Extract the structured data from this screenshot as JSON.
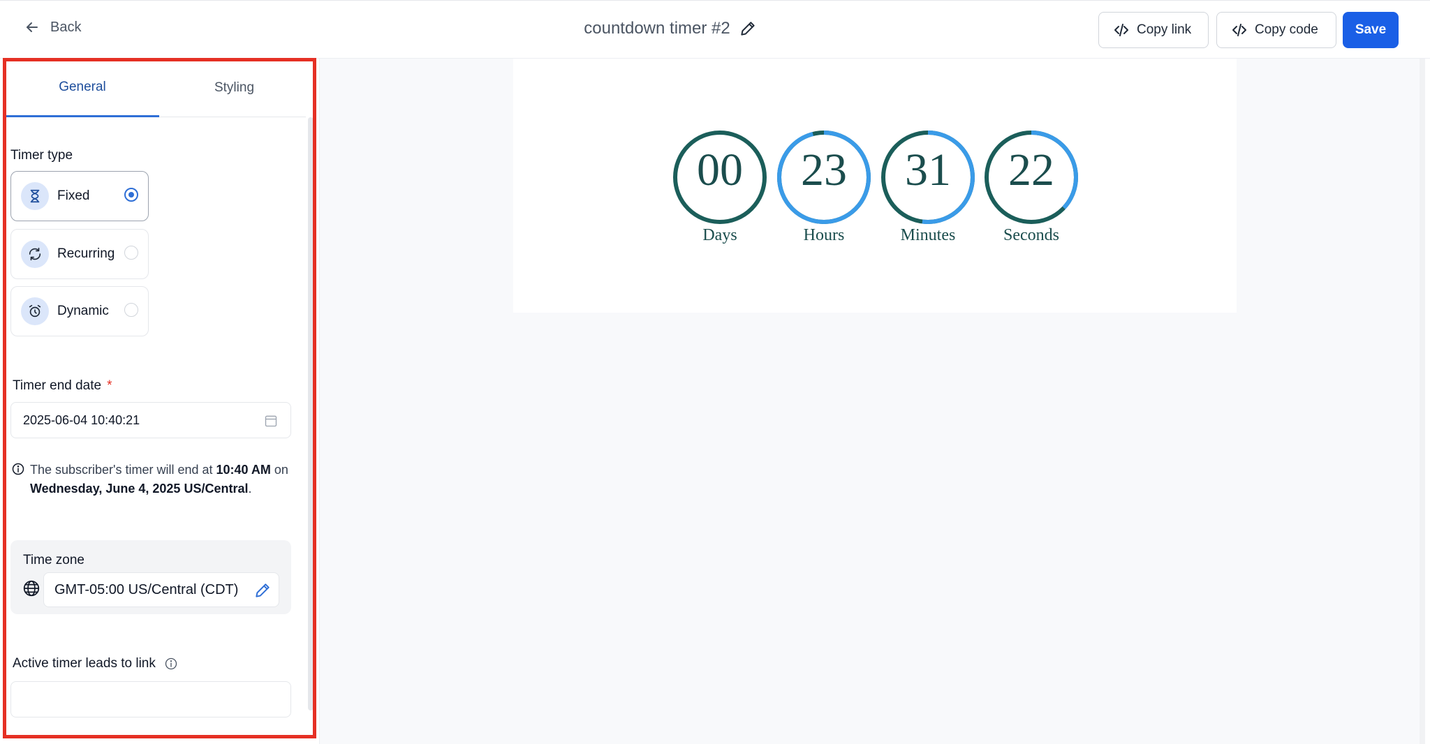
{
  "header": {
    "back_label": "Back",
    "title": "countdown timer #2",
    "copy_link_label": "Copy link",
    "copy_code_label": "Copy code",
    "save_label": "Save",
    "accent": "#1a5fe6"
  },
  "sidebar": {
    "tabs": [
      {
        "label": "General",
        "active": true
      },
      {
        "label": "Styling",
        "active": false
      }
    ],
    "timer_type_label": "Timer type",
    "timer_types": [
      {
        "label": "Fixed",
        "icon": "hourglass-icon",
        "selected": true
      },
      {
        "label": "Recurring",
        "icon": "refresh-icon",
        "selected": false
      },
      {
        "label": "Dynamic",
        "icon": "alarm-clock-icon",
        "selected": false
      }
    ],
    "end_date_label": "Timer end date",
    "required_mark": "*",
    "end_date_value": "2025-06-04 10:40:21",
    "info": {
      "pre": "The subscriber's timer will end at ",
      "time": "10:40 AM",
      "mid": " on ",
      "date": "Wednesday, June 4, 2025 US/Central",
      "post": "."
    },
    "timezone_label": "Time zone",
    "timezone_value": "GMT-05:00 US/Central (CDT)",
    "link_label": "Active timer leads to link",
    "link_value": ""
  },
  "preview": {
    "units": [
      {
        "value": "00",
        "label": "Days",
        "progress": 0
      },
      {
        "value": "23",
        "label": "Hours",
        "progress": 0.96
      },
      {
        "value": "31",
        "label": "Minutes",
        "progress": 0.52
      },
      {
        "value": "22",
        "label": "Seconds",
        "progress": 0.37
      }
    ],
    "ring_color": "#1b5e5a",
    "progress_color": "#3a9be8",
    "text_color": "#1b4d4d"
  },
  "highlight_color": "#e53024"
}
